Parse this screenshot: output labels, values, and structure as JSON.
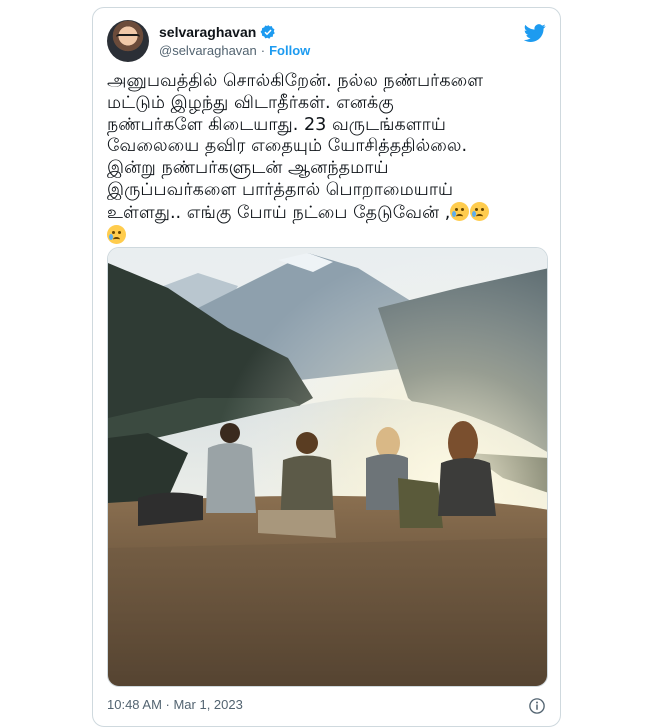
{
  "user": {
    "display_name": "selvaraghavan",
    "handle": "@selvaraghavan",
    "separator": "·",
    "follow_label": "Follow",
    "verified": true
  },
  "tweet": {
    "lines": [
      "அனுபவத்தில் சொல்கிறேன். நல்ல நண்பர்களை",
      "மட்டும் இழந்து விடாதீர்கள். எனக்கு",
      "நண்பர்களே கிடையாது. 23 வருடங்களாய்",
      "வேலையை தவிர எதையும் யோசித்ததில்லை.",
      "இன்று நண்பர்களுடன் ஆனந்தமாய்",
      "இருப்பவர்களை பார்த்தால் பொறாமையாய்",
      "உள்ளது.. எங்கு போய் நட்பை தேடுவேன் ,"
    ],
    "emojis": [
      "sad-but-relieved-face",
      "sad-but-relieved-face",
      "sad-but-relieved-face"
    ],
    "timestamp": "10:48 AM · Mar 1, 2023"
  },
  "colors": {
    "accent": "#1d9bf0",
    "text": "#0f1419",
    "muted": "#536471",
    "border": "#cfd9de"
  },
  "icons": {
    "brand": "twitter-bird-icon",
    "verified": "verified-badge-icon",
    "info": "info-icon"
  }
}
